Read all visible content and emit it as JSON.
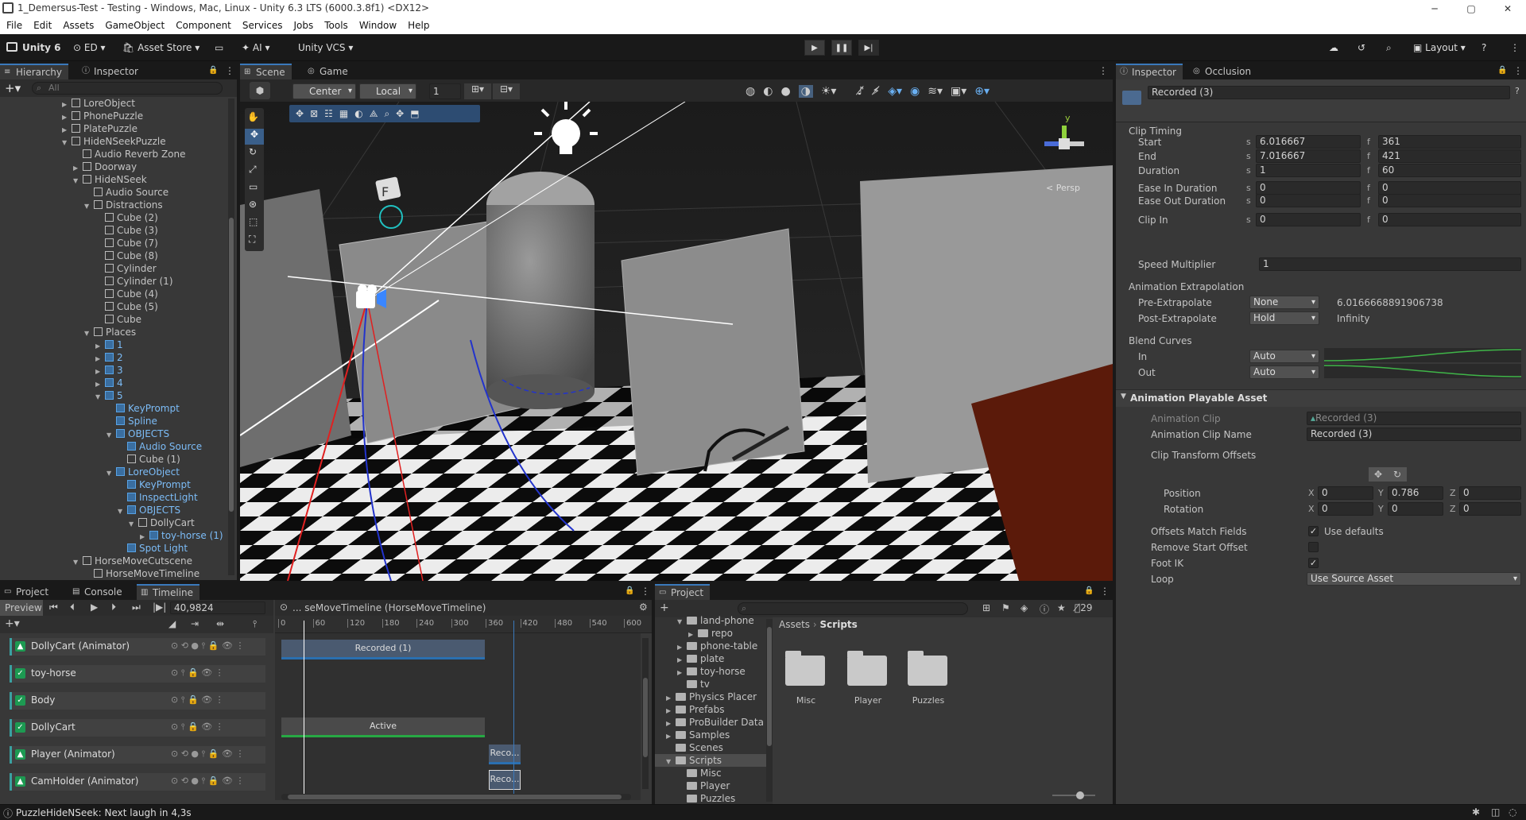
{
  "window": {
    "title": "1_Demersus-Test - Testing - Windows, Mac, Linux - Unity 6.3 LTS (6000.3.8f1) <DX12>"
  },
  "menu": [
    "File",
    "Edit",
    "Assets",
    "GameObject",
    "Component",
    "Services",
    "Jobs",
    "Tools",
    "Window",
    "Help"
  ],
  "toolbar": {
    "unity_label": "Unity 6",
    "account": "ED",
    "asset_store": "Asset Store",
    "ai": "AI",
    "vcs": "Unity VCS",
    "layout": "Layout"
  },
  "hierarchy": {
    "tabs": [
      "Hierarchy",
      "Inspector"
    ],
    "search_placeholder": "All",
    "items": [
      {
        "name": "LoreObject",
        "indent": 0,
        "expand": "right",
        "blue": false
      },
      {
        "name": "PhonePuzzle",
        "indent": 0,
        "expand": "right",
        "blue": false
      },
      {
        "name": "PlatePuzzle",
        "indent": 0,
        "expand": "right",
        "blue": false
      },
      {
        "name": "HideNSeekPuzzle",
        "indent": 0,
        "expand": "down",
        "blue": false
      },
      {
        "name": "Audio Reverb Zone",
        "indent": 1,
        "expand": "",
        "blue": false
      },
      {
        "name": "Doorway",
        "indent": 1,
        "expand": "right",
        "blue": false
      },
      {
        "name": "HideNSeek",
        "indent": 1,
        "expand": "down",
        "blue": false
      },
      {
        "name": "Audio Source",
        "indent": 2,
        "expand": "",
        "blue": false
      },
      {
        "name": "Distractions",
        "indent": 2,
        "expand": "down",
        "blue": false
      },
      {
        "name": "Cube (2)",
        "indent": 3,
        "expand": "",
        "blue": false
      },
      {
        "name": "Cube (3)",
        "indent": 3,
        "expand": "",
        "blue": false
      },
      {
        "name": "Cube (7)",
        "indent": 3,
        "expand": "",
        "blue": false
      },
      {
        "name": "Cube (8)",
        "indent": 3,
        "expand": "",
        "blue": false
      },
      {
        "name": "Cylinder",
        "indent": 3,
        "expand": "",
        "blue": false
      },
      {
        "name": "Cylinder (1)",
        "indent": 3,
        "expand": "",
        "blue": false
      },
      {
        "name": "Cube (4)",
        "indent": 3,
        "expand": "",
        "blue": false
      },
      {
        "name": "Cube (5)",
        "indent": 3,
        "expand": "",
        "blue": false
      },
      {
        "name": "Cube",
        "indent": 3,
        "expand": "",
        "blue": false
      },
      {
        "name": "Places",
        "indent": 2,
        "expand": "down",
        "blue": false
      },
      {
        "name": "1",
        "indent": 3,
        "expand": "right",
        "blue": true
      },
      {
        "name": "2",
        "indent": 3,
        "expand": "right",
        "blue": true
      },
      {
        "name": "3",
        "indent": 3,
        "expand": "right",
        "blue": true
      },
      {
        "name": "4",
        "indent": 3,
        "expand": "right",
        "blue": true
      },
      {
        "name": "5",
        "indent": 3,
        "expand": "down",
        "blue": true
      },
      {
        "name": "KeyPrompt",
        "indent": 4,
        "expand": "",
        "blue": true
      },
      {
        "name": "Spline",
        "indent": 4,
        "expand": "",
        "blue": true
      },
      {
        "name": "OBJECTS",
        "indent": 4,
        "expand": "down",
        "blue": true
      },
      {
        "name": "Audio Source",
        "indent": 5,
        "expand": "",
        "blue": true
      },
      {
        "name": "Cube (1)",
        "indent": 5,
        "expand": "",
        "blue": false
      },
      {
        "name": "LoreObject",
        "indent": 4,
        "expand": "down",
        "blue": true
      },
      {
        "name": "KeyPrompt",
        "indent": 5,
        "expand": "",
        "blue": true
      },
      {
        "name": "InspectLight",
        "indent": 5,
        "expand": "",
        "blue": true
      },
      {
        "name": "OBJECTS",
        "indent": 5,
        "expand": "down",
        "blue": true
      },
      {
        "name": "DollyCart",
        "indent": 6,
        "expand": "down",
        "blue": false
      },
      {
        "name": "toy-horse (1)",
        "indent": 7,
        "expand": "right",
        "blue": true
      },
      {
        "name": "Spot Light",
        "indent": 5,
        "expand": "",
        "blue": true
      },
      {
        "name": "HorseMoveCutscene",
        "indent": 1,
        "expand": "down",
        "blue": false
      },
      {
        "name": "HorseMoveTimeline",
        "indent": 2,
        "expand": "",
        "blue": false
      }
    ]
  },
  "scene": {
    "tabs": [
      "Scene",
      "Game"
    ],
    "pivot": "Center",
    "space": "Local",
    "snap_value": "1",
    "persp_label": "< Persp",
    "gizmo_axis": "y"
  },
  "bottom_left": {
    "tabs": [
      "Project",
      "Console",
      "Timeline"
    ],
    "preview_label": "Preview",
    "time_value": "40,9824",
    "timeline_name": "... seMoveTimeline (HorseMoveTimeline)",
    "ruler_ticks": [
      "0",
      "60",
      "120",
      "180",
      "240",
      "300",
      "360",
      "420",
      "480",
      "540",
      "600"
    ],
    "tracks": [
      {
        "name": "DollyCart (Animator)",
        "icon": "animator"
      },
      {
        "name": "toy-horse",
        "icon": "activation"
      },
      {
        "name": "Body",
        "icon": "activation"
      },
      {
        "name": "DollyCart",
        "icon": "activation"
      },
      {
        "name": "Player (Animator)",
        "icon": "animator"
      },
      {
        "name": "CamHolder (Animator)",
        "icon": "animator"
      }
    ],
    "clips": {
      "recorded": "Recorded (1)",
      "active": "Active",
      "reco1": "Reco...",
      "reco2": "Reco..."
    }
  },
  "project": {
    "tab": "Project",
    "search_placeholder": "",
    "hidden_count": "29",
    "breadcrumb": [
      "Assets",
      "Scripts"
    ],
    "tree": [
      {
        "name": "land-phone",
        "indent": 1,
        "expand": "down"
      },
      {
        "name": "repo",
        "indent": 2,
        "expand": "right"
      },
      {
        "name": "phone-table",
        "indent": 1,
        "expand": "right"
      },
      {
        "name": "plate",
        "indent": 1,
        "expand": "right"
      },
      {
        "name": "toy-horse",
        "indent": 1,
        "expand": "right"
      },
      {
        "name": "tv",
        "indent": 1,
        "expand": ""
      },
      {
        "name": "Physics Placer",
        "indent": 0,
        "expand": "right"
      },
      {
        "name": "Prefabs",
        "indent": 0,
        "expand": "right"
      },
      {
        "name": "ProBuilder Data",
        "indent": 0,
        "expand": "right"
      },
      {
        "name": "Samples",
        "indent": 0,
        "expand": "right"
      },
      {
        "name": "Scenes",
        "indent": 0,
        "expand": ""
      },
      {
        "name": "Scripts",
        "indent": 0,
        "expand": "down"
      },
      {
        "name": "Misc",
        "indent": 1,
        "expand": ""
      },
      {
        "name": "Player",
        "indent": 1,
        "expand": ""
      },
      {
        "name": "Puzzles",
        "indent": 1,
        "expand": ""
      }
    ],
    "folders": [
      "Misc",
      "Player",
      "Puzzles"
    ]
  },
  "inspector": {
    "tabs": [
      "Inspector",
      "Occlusion"
    ],
    "object_name": "Recorded (3)",
    "clip_timing": {
      "header": "Clip Timing",
      "rows": [
        {
          "label": "Start",
          "s": "6.016667",
          "f": "361"
        },
        {
          "label": "End",
          "s": "7.016667",
          "f": "421"
        },
        {
          "label": "Duration",
          "s": "1",
          "f": "60"
        },
        {
          "label": "Ease In Duration",
          "s": "0",
          "f": "0"
        },
        {
          "label": "Ease Out Duration",
          "s": "0",
          "f": "0"
        },
        {
          "label": "Clip In",
          "s": "0",
          "f": "0"
        }
      ],
      "speed_label": "Speed Multiplier",
      "speed_value": "1"
    },
    "extrapolation": {
      "header": "Animation Extrapolation",
      "pre_label": "Pre-Extrapolate",
      "pre_value": "None",
      "pre_info": "6.0166668891906738",
      "post_label": "Post-Extrapolate",
      "post_value": "Hold",
      "post_info": "Infinity"
    },
    "blend": {
      "header": "Blend Curves",
      "in_label": "In",
      "in_value": "Auto",
      "out_label": "Out",
      "out_value": "Auto"
    },
    "playable": {
      "header": "Animation Playable Asset",
      "clip_label": "Animation Clip",
      "clip_value": "Recorded (3)",
      "clipname_label": "Animation Clip Name",
      "clipname_value": "Recorded (3)",
      "offsets_label": "Clip Transform Offsets",
      "position_label": "Position",
      "position": {
        "x": "0",
        "y": "0.786",
        "z": "0"
      },
      "rotation_label": "Rotation",
      "rotation": {
        "x": "0",
        "y": "0",
        "z": "0"
      },
      "match_label": "Offsets Match Fields",
      "match_value": "Use defaults",
      "remove_label": "Remove Start Offset",
      "foot_label": "Foot IK",
      "loop_label": "Loop",
      "loop_value": "Use Source Asset"
    }
  },
  "statusbar": {
    "message": "PuzzleHideNSeek: Next laugh in 4,3s"
  }
}
